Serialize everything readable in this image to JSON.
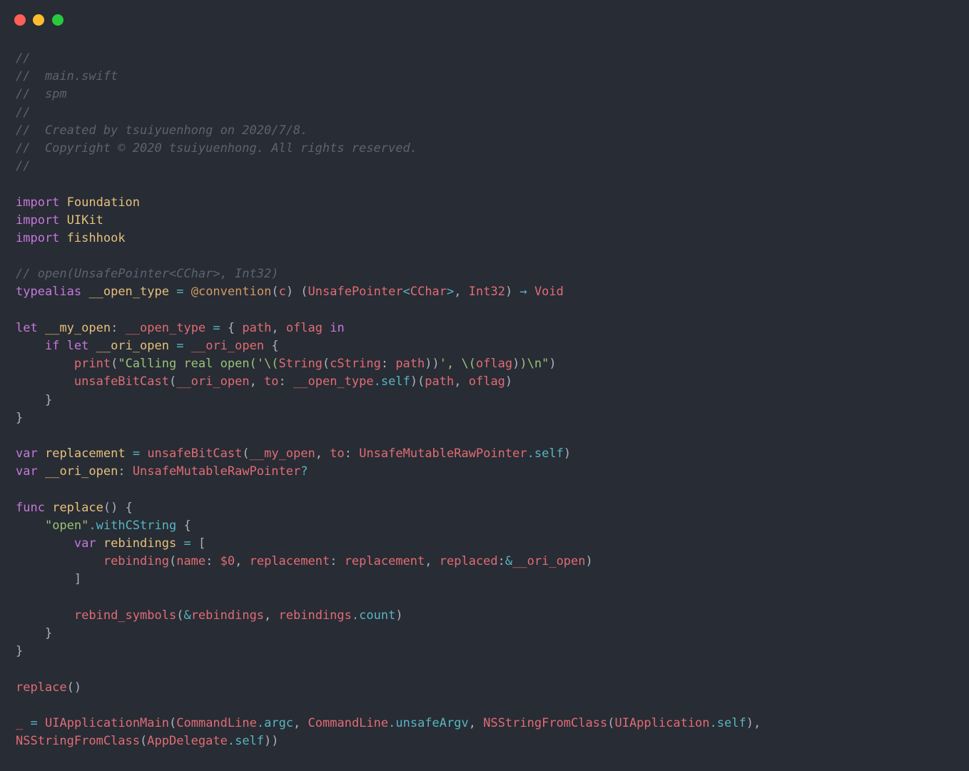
{
  "colors": {
    "background": "#282c34",
    "traffic_close": "#ff5f56",
    "traffic_minimize": "#ffbd2e",
    "traffic_zoom": "#27c93f"
  },
  "window": {
    "buttons": [
      "close-button",
      "minimize-button",
      "zoom-button"
    ]
  },
  "code": {
    "language": "swift",
    "lines": [
      [
        [
          "comment",
          "//"
        ]
      ],
      [
        [
          "comment",
          "//  main.swift"
        ]
      ],
      [
        [
          "comment",
          "//  spm"
        ]
      ],
      [
        [
          "comment",
          "//"
        ]
      ],
      [
        [
          "comment",
          "//  Created by tsuiyuenhong on 2020/7/8."
        ]
      ],
      [
        [
          "comment",
          "//  Copyright © 2020 tsuiyuenhong. All rights reserved."
        ]
      ],
      [
        [
          "comment",
          "//"
        ]
      ],
      [],
      [
        [
          "keyword",
          "import"
        ],
        [
          "plain",
          " "
        ],
        [
          "type",
          "Foundation"
        ]
      ],
      [
        [
          "keyword",
          "import"
        ],
        [
          "plain",
          " "
        ],
        [
          "type",
          "UIKit"
        ]
      ],
      [
        [
          "keyword",
          "import"
        ],
        [
          "plain",
          " "
        ],
        [
          "type",
          "fishhook"
        ]
      ],
      [],
      [
        [
          "comment",
          "// open(UnsafePointer<CChar>, Int32)"
        ]
      ],
      [
        [
          "keyword",
          "typealias"
        ],
        [
          "plain",
          " "
        ],
        [
          "name",
          "__open_type"
        ],
        [
          "plain",
          " "
        ],
        [
          "op",
          "="
        ],
        [
          "plain",
          " "
        ],
        [
          "attr",
          "@convention"
        ],
        [
          "plain",
          "("
        ],
        [
          "param",
          "c"
        ],
        [
          "plain",
          ") ("
        ],
        [
          "fn",
          "UnsafePointer"
        ],
        [
          "op",
          "<"
        ],
        [
          "fn",
          "CChar"
        ],
        [
          "op",
          ">"
        ],
        [
          "plain",
          ", "
        ],
        [
          "fn",
          "Int32"
        ],
        [
          "plain",
          ") "
        ],
        [
          "op",
          "→"
        ],
        [
          "plain",
          " "
        ],
        [
          "fn",
          "Void"
        ]
      ],
      [],
      [
        [
          "keyword",
          "let"
        ],
        [
          "plain",
          " "
        ],
        [
          "name",
          "__my_open"
        ],
        [
          "plain",
          ": "
        ],
        [
          "fn",
          "__open_type"
        ],
        [
          "plain",
          " "
        ],
        [
          "op",
          "="
        ],
        [
          "plain",
          " { "
        ],
        [
          "param",
          "path"
        ],
        [
          "plain",
          ", "
        ],
        [
          "param",
          "oflag"
        ],
        [
          "plain",
          " "
        ],
        [
          "keyword",
          "in"
        ]
      ],
      [
        [
          "plain",
          "    "
        ],
        [
          "keyword",
          "if let"
        ],
        [
          "plain",
          " "
        ],
        [
          "name",
          "__ori_open"
        ],
        [
          "plain",
          " "
        ],
        [
          "op",
          "="
        ],
        [
          "plain",
          " "
        ],
        [
          "fn",
          "__ori_open"
        ],
        [
          "plain",
          " {"
        ]
      ],
      [
        [
          "plain",
          "        "
        ],
        [
          "fn",
          "print"
        ],
        [
          "plain",
          "("
        ],
        [
          "string",
          "\"Calling real open('\\("
        ],
        [
          "fn",
          "String"
        ],
        [
          "plain",
          "("
        ],
        [
          "param",
          "cString"
        ],
        [
          "plain",
          ": "
        ],
        [
          "param",
          "path"
        ],
        [
          "plain",
          "))"
        ],
        [
          "string",
          "', \\("
        ],
        [
          "param",
          "oflag"
        ],
        [
          "plain",
          ")"
        ],
        [
          "string",
          ")\\n\""
        ],
        [
          "plain",
          ")"
        ]
      ],
      [
        [
          "plain",
          "        "
        ],
        [
          "fn",
          "unsafeBitCast"
        ],
        [
          "plain",
          "("
        ],
        [
          "fn",
          "__ori_open"
        ],
        [
          "plain",
          ", "
        ],
        [
          "param",
          "to"
        ],
        [
          "plain",
          ": "
        ],
        [
          "fn",
          "__open_type"
        ],
        [
          "op",
          "."
        ],
        [
          "op",
          "self"
        ],
        [
          "plain",
          ")("
        ],
        [
          "param",
          "path"
        ],
        [
          "plain",
          ", "
        ],
        [
          "param",
          "oflag"
        ],
        [
          "plain",
          ")"
        ]
      ],
      [
        [
          "plain",
          "    }"
        ]
      ],
      [
        [
          "plain",
          "}"
        ]
      ],
      [],
      [
        [
          "keyword",
          "var"
        ],
        [
          "plain",
          " "
        ],
        [
          "name",
          "replacement"
        ],
        [
          "plain",
          " "
        ],
        [
          "op",
          "="
        ],
        [
          "plain",
          " "
        ],
        [
          "fn",
          "unsafeBitCast"
        ],
        [
          "plain",
          "("
        ],
        [
          "fn",
          "__my_open"
        ],
        [
          "plain",
          ", "
        ],
        [
          "param",
          "to"
        ],
        [
          "plain",
          ": "
        ],
        [
          "fn",
          "UnsafeMutableRawPointer"
        ],
        [
          "op",
          "."
        ],
        [
          "op",
          "self"
        ],
        [
          "plain",
          ")"
        ]
      ],
      [
        [
          "keyword",
          "var"
        ],
        [
          "plain",
          " "
        ],
        [
          "name",
          "__ori_open"
        ],
        [
          "plain",
          ": "
        ],
        [
          "fn",
          "UnsafeMutableRawPointer"
        ],
        [
          "op",
          "?"
        ]
      ],
      [],
      [
        [
          "keyword",
          "func"
        ],
        [
          "plain",
          " "
        ],
        [
          "name",
          "replace"
        ],
        [
          "plain",
          "() {"
        ]
      ],
      [
        [
          "plain",
          "    "
        ],
        [
          "string",
          "\"open\""
        ],
        [
          "op",
          "."
        ],
        [
          "op",
          "withCString"
        ],
        [
          "plain",
          " {"
        ]
      ],
      [
        [
          "plain",
          "        "
        ],
        [
          "keyword",
          "var"
        ],
        [
          "plain",
          " "
        ],
        [
          "name",
          "rebindings"
        ],
        [
          "plain",
          " "
        ],
        [
          "op",
          "="
        ],
        [
          "plain",
          " ["
        ]
      ],
      [
        [
          "plain",
          "            "
        ],
        [
          "fn",
          "rebinding"
        ],
        [
          "plain",
          "("
        ],
        [
          "param",
          "name"
        ],
        [
          "plain",
          ": "
        ],
        [
          "param",
          "$0"
        ],
        [
          "plain",
          ", "
        ],
        [
          "param",
          "replacement"
        ],
        [
          "plain",
          ": "
        ],
        [
          "fn",
          "replacement"
        ],
        [
          "plain",
          ", "
        ],
        [
          "param",
          "replaced"
        ],
        [
          "plain",
          ":"
        ],
        [
          "op",
          "&"
        ],
        [
          "fn",
          "__ori_open"
        ],
        [
          "plain",
          ")"
        ]
      ],
      [
        [
          "plain",
          "        ]"
        ]
      ],
      [],
      [
        [
          "plain",
          "        "
        ],
        [
          "fn",
          "rebind_symbols"
        ],
        [
          "plain",
          "("
        ],
        [
          "op",
          "&"
        ],
        [
          "fn",
          "rebindings"
        ],
        [
          "plain",
          ", "
        ],
        [
          "fn",
          "rebindings"
        ],
        [
          "op",
          "."
        ],
        [
          "op",
          "count"
        ],
        [
          "plain",
          ")"
        ]
      ],
      [
        [
          "plain",
          "    }"
        ]
      ],
      [
        [
          "plain",
          "}"
        ]
      ],
      [],
      [
        [
          "fn",
          "replace"
        ],
        [
          "plain",
          "()"
        ]
      ],
      [],
      [
        [
          "fn",
          "_"
        ],
        [
          "plain",
          " "
        ],
        [
          "op",
          "="
        ],
        [
          "plain",
          " "
        ],
        [
          "fn",
          "UIApplicationMain"
        ],
        [
          "plain",
          "("
        ],
        [
          "fn",
          "CommandLine"
        ],
        [
          "op",
          "."
        ],
        [
          "op",
          "argc"
        ],
        [
          "plain",
          ", "
        ],
        [
          "fn",
          "CommandLine"
        ],
        [
          "op",
          "."
        ],
        [
          "op",
          "unsafeArgv"
        ],
        [
          "plain",
          ", "
        ],
        [
          "fn",
          "NSStringFromClass"
        ],
        [
          "plain",
          "("
        ],
        [
          "fn",
          "UIApplication"
        ],
        [
          "op",
          "."
        ],
        [
          "op",
          "self"
        ],
        [
          "plain",
          "),"
        ]
      ],
      [
        [
          "fn",
          "NSStringFromClass"
        ],
        [
          "plain",
          "("
        ],
        [
          "fn",
          "AppDelegate"
        ],
        [
          "op",
          "."
        ],
        [
          "op",
          "self"
        ],
        [
          "plain",
          "))"
        ]
      ]
    ]
  }
}
